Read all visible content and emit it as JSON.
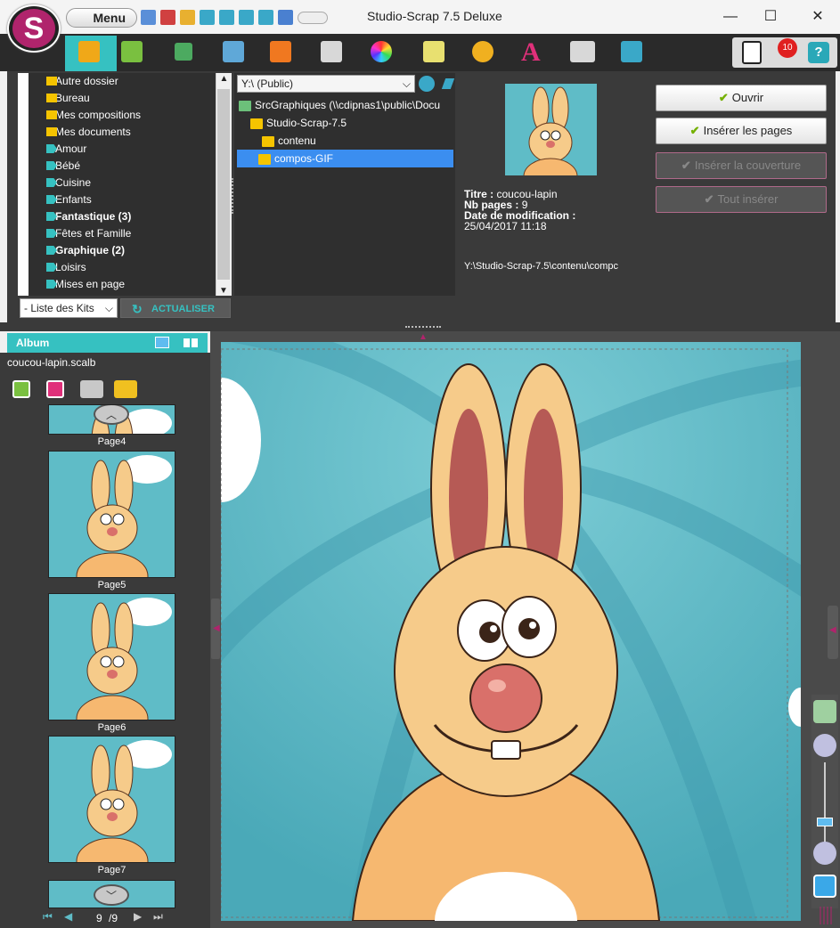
{
  "window": {
    "title": "Studio-Scrap 7.5 Deluxe",
    "menu_label": "Menu",
    "logo_letter": "S",
    "minimize": "—",
    "maximize": "☐",
    "close": "✕"
  },
  "toolbar": {
    "notification_count": "10",
    "help": "?"
  },
  "kits": {
    "items": [
      {
        "label": "Autre dossier",
        "icon": "folder-icon",
        "bold": false
      },
      {
        "label": "Bureau",
        "icon": "folder-icon",
        "bold": false
      },
      {
        "label": "Mes compositions",
        "icon": "folder-icon",
        "bold": false
      },
      {
        "label": "Mes documents",
        "icon": "folder-icon",
        "bold": false
      },
      {
        "label": "Amour",
        "icon": "tag-icon",
        "bold": false
      },
      {
        "label": "Bébé",
        "icon": "tag-icon",
        "bold": false
      },
      {
        "label": "Cuisine",
        "icon": "tag-icon",
        "bold": false
      },
      {
        "label": "Enfants",
        "icon": "tag-icon",
        "bold": false
      },
      {
        "label": "Fantastique (3)",
        "icon": "tag-icon",
        "bold": true
      },
      {
        "label": "Fêtes et Famille",
        "icon": "tag-icon",
        "bold": false
      },
      {
        "label": "Graphique (2)",
        "icon": "tag-icon",
        "bold": true
      },
      {
        "label": "Loisirs",
        "icon": "tag-icon",
        "bold": false
      },
      {
        "label": "Mises en page",
        "icon": "tag-icon",
        "bold": false
      }
    ],
    "list_select": "- Liste des Kits",
    "refresh_label": "ACTUALISER"
  },
  "folders": {
    "drive": "Y:\\ (Public)",
    "tree": [
      {
        "label": "SrcGraphiques (\\\\cdipnas1\\public\\Docu",
        "depth": 0,
        "selected": false
      },
      {
        "label": "Studio-Scrap-7.5",
        "depth": 1,
        "selected": false
      },
      {
        "label": "contenu",
        "depth": 2,
        "selected": false
      },
      {
        "label": "compos-GIF",
        "depth": 3,
        "selected": true
      }
    ]
  },
  "details": {
    "title_label": "Titre :",
    "title_value": "coucou-lapin",
    "pages_label": "Nb pages :",
    "pages_value": "9",
    "date_label": "Date de modification :",
    "date_value": "25/04/2017 11:18",
    "path": "Y:\\Studio-Scrap-7.5\\contenu\\compc"
  },
  "actions": {
    "open": "Ouvrir",
    "insert_pages": "Insérer les pages",
    "insert_cover": "Insérer la couverture",
    "insert_all": "Tout insérer"
  },
  "album": {
    "header": "Album",
    "filename": "coucou-lapin.scalb",
    "pages": [
      "Page4",
      "Page5",
      "Page6",
      "Page7"
    ],
    "current_page": "9",
    "total_pages": "/9"
  },
  "colors": {
    "accent": "#36c1c1",
    "dark_panel": "#3a3a3a",
    "brand": "#b0246c",
    "selection": "#3b8ef0"
  }
}
